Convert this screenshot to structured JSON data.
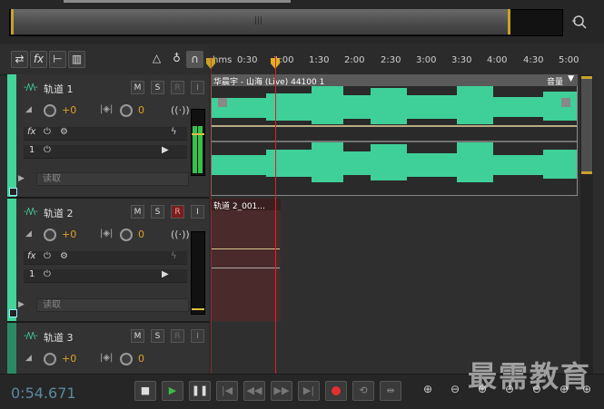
{
  "ruler": {
    "labels": [
      "hms",
      "0:30",
      "1:00",
      "1:30",
      "2:00",
      "2:30",
      "3:00",
      "3:30",
      "4:00",
      "4:30",
      "5:00"
    ]
  },
  "tracks": [
    {
      "name": "轨道 1",
      "mute": "M",
      "solo": "S",
      "rec": "R",
      "input": "I",
      "volume": "+0",
      "pan": "0",
      "slot1": "1",
      "mode": "读取"
    },
    {
      "name": "轨道 2",
      "mute": "M",
      "solo": "S",
      "rec": "R",
      "input": "I",
      "volume": "+0",
      "pan": "0",
      "slot1": "1",
      "mode": "读取"
    },
    {
      "name": "轨道 3",
      "mute": "M",
      "solo": "S",
      "rec": "R",
      "input": "I",
      "volume": "+0",
      "pan": "0"
    }
  ],
  "clips": {
    "clip1_title": "华晨宇 - 山海 (Live) 44100 1",
    "clip1_param": "音量",
    "clip2_title": "轨道 2_001..."
  },
  "transport": {
    "timecode": "0:54.671"
  },
  "watermark": "最需教育",
  "colors": {
    "track": "#42d49a",
    "playhead": "#e02020",
    "accent": "#c9a227",
    "timecode": "#5a8aa0"
  }
}
